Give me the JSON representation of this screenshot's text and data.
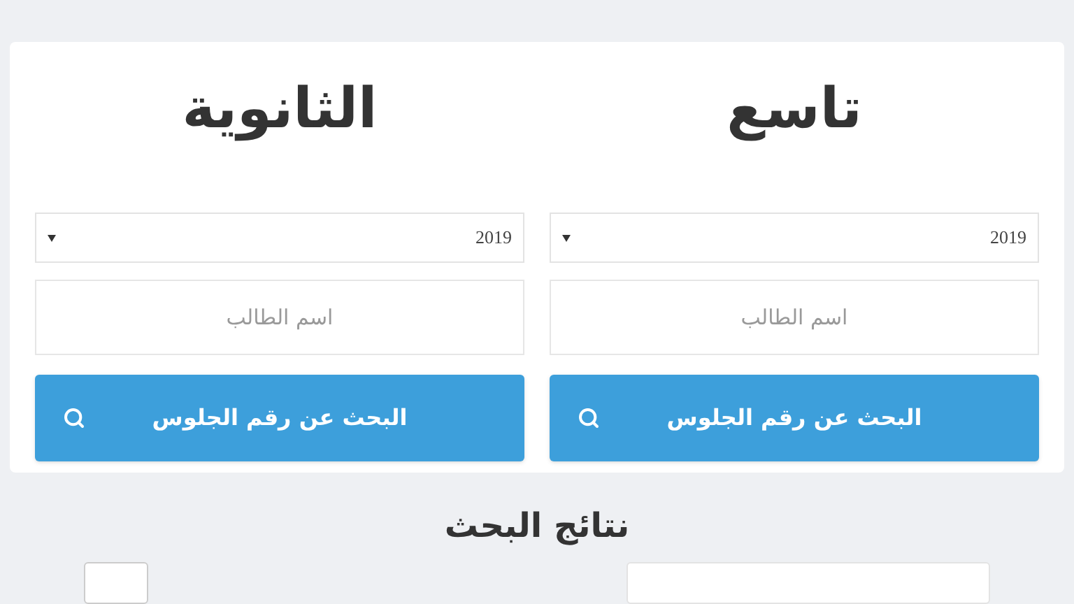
{
  "forms": [
    {
      "title": "تاسع",
      "year_select": {
        "value": "2019"
      },
      "name_field": {
        "placeholder": "اسم الطالب"
      },
      "search_button": {
        "label": "البحث عن رقم الجلوس"
      }
    },
    {
      "title": "الثانوية",
      "year_select": {
        "value": "2019"
      },
      "name_field": {
        "placeholder": "اسم الطالب"
      },
      "search_button": {
        "label": "البحث عن رقم الجلوس"
      }
    }
  ],
  "results": {
    "heading": "نتائج البحث"
  }
}
